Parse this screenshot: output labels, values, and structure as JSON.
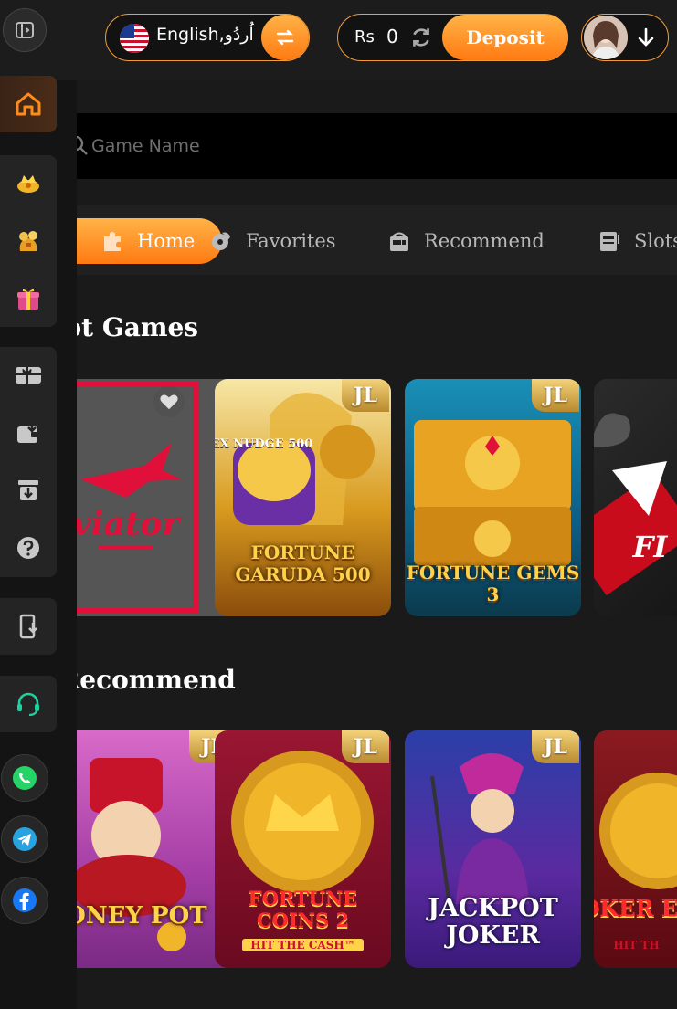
{
  "header": {
    "language_label": "English,اُردُو",
    "currency": "Rs",
    "balance": "0",
    "deposit_label": "Deposit"
  },
  "search": {
    "placeholder": "Game Name"
  },
  "tabs": [
    {
      "label": "Home",
      "icon": "puzzle-icon",
      "active": true
    },
    {
      "label": "Favorites",
      "icon": "favorites-icon"
    },
    {
      "label": "Recommend",
      "icon": "slot-machine-icon"
    },
    {
      "label": "Slots",
      "icon": "slots-icon"
    }
  ],
  "sections": {
    "hot_games_title": "Hot Games",
    "recommend_title": "Recommend"
  },
  "hot_games": [
    {
      "title": "Aviator",
      "badge": ""
    },
    {
      "title": "FORTUNE GARUDA 500",
      "badge": "JL",
      "top_label": "EX NUDGE 500"
    },
    {
      "title": "FORTUNE GEMS 3",
      "badge": "JL"
    },
    {
      "title": "FI",
      "badge": ""
    }
  ],
  "recommend_games": [
    {
      "title": "MONEY POT",
      "badge": "JL"
    },
    {
      "title": "FORTUNE COINS 2",
      "badge": "JL",
      "subtitle": "HIT THE CASH™"
    },
    {
      "title": "JACKPOT JOKER",
      "badge": "JL"
    },
    {
      "title": "JOKER Expa",
      "badge": "",
      "subtitle": "HIT TH"
    }
  ],
  "colors": {
    "accent": "#ff8c1a",
    "background": "#1a1a1a",
    "sidebar": "#141414"
  }
}
